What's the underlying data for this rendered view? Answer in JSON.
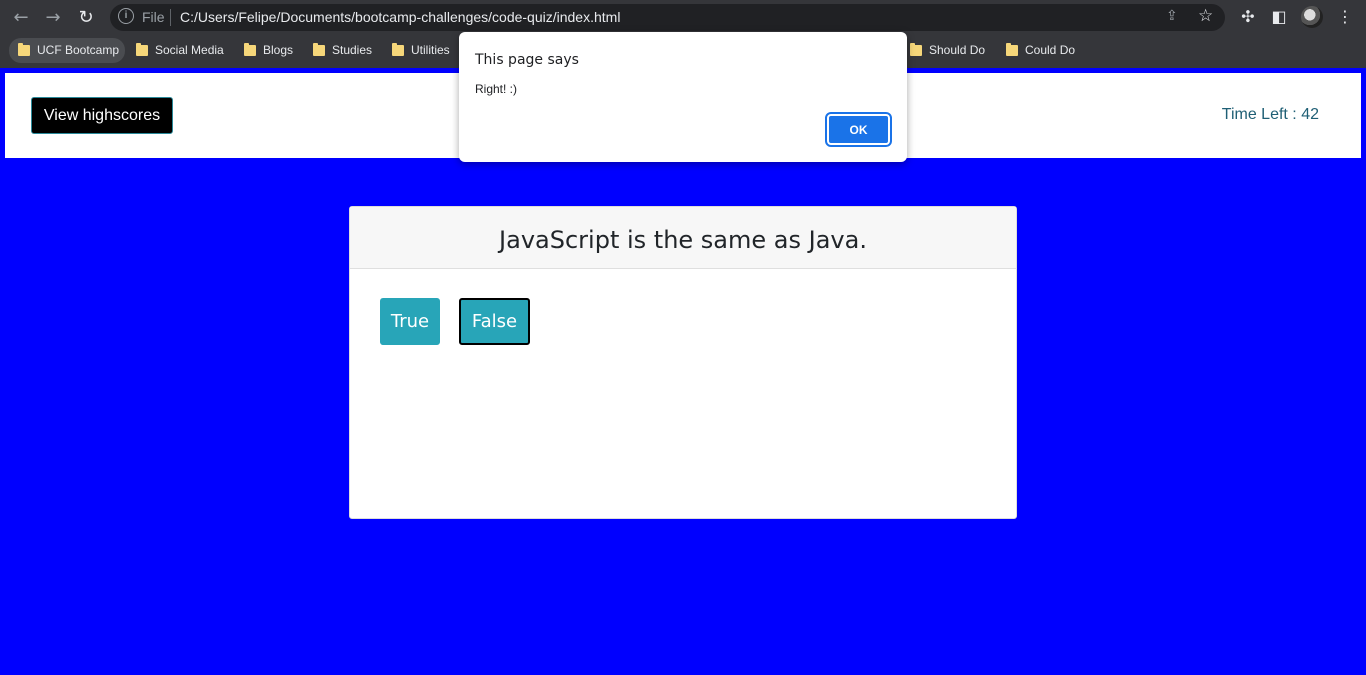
{
  "browser": {
    "url_scheme_label": "File",
    "url": "C:/Users/Felipe/Documents/bootcamp-challenges/code-quiz/index.html",
    "bookmarks": [
      {
        "label": "UCF Bootcamp"
      },
      {
        "label": "Social Media"
      },
      {
        "label": "Blogs"
      },
      {
        "label": "Studies"
      },
      {
        "label": "Utilities"
      },
      {
        "label": "Should Do"
      },
      {
        "label": "Could Do"
      }
    ]
  },
  "header": {
    "highscores_label": "View highscores",
    "timer_text": "Time Left : 42"
  },
  "quiz": {
    "question": "JavaScript is the same as Java.",
    "answers": [
      {
        "label": "True"
      },
      {
        "label": "False"
      }
    ]
  },
  "dialog": {
    "title": "This page says",
    "message": "Right! :)",
    "ok_label": "OK"
  },
  "colors": {
    "page_background": "#0000ff",
    "answer_button": "#28a5b8",
    "timer_text": "#1f5f75",
    "dialog_ok": "#1a73e8"
  }
}
